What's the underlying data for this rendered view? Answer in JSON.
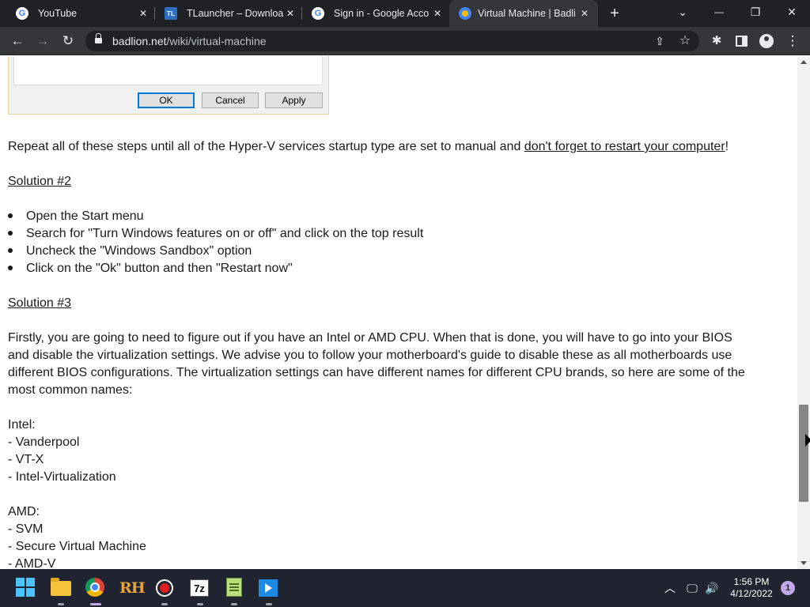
{
  "browser": {
    "tabs": [
      {
        "title": "YouTube",
        "close": "✕"
      },
      {
        "title": "TLauncher – Download",
        "favicon_text": "TL",
        "close": "✕"
      },
      {
        "title": "Sign in - Google Accou",
        "close": "✕"
      },
      {
        "title": "Virtual Machine | Badlio",
        "close": "✕"
      }
    ],
    "new_tab": "+",
    "window": {
      "dropdown": "⌄",
      "minimize": "—",
      "restore": "❐",
      "close": "✕"
    },
    "nav": {
      "back": "←",
      "forward": "→",
      "reload": "↻"
    },
    "url": {
      "host": "badlion.net",
      "path": "/wiki/virtual-machine"
    },
    "icons": {
      "share": "⇪",
      "bookmark": "☆",
      "extensions": "✱",
      "menu": "⋮"
    }
  },
  "dialog": {
    "ok_label": "OK",
    "cancel_label": "Cancel",
    "apply_label": "Apply"
  },
  "article": {
    "repeat_text": "Repeat all of these steps until all of the Hyper-V services startup type are set to manual and ",
    "repeat_link": "don't forget to restart your computer",
    "repeat_end": "!",
    "solution2_heading": "Solution #2",
    "solution2_steps": [
      "Open the Start menu",
      "Search for \"Turn Windows features on or off\" and click on the top result",
      "Uncheck the \"Windows Sandbox\" option",
      "Click on the \"Ok\" button and then \"Restart now\""
    ],
    "solution3_heading": "Solution #3",
    "solution3_paragraph": [
      "Firstly, you are going to need to figure out if you have an Intel or AMD CPU. When that is done, you will have to go into your BIOS",
      "and disable the virtualization settings. We advise you to follow your motherboard's guide to disable these as all motherboards use",
      "different BIOS configurations. The virtualization settings can have different names for different CPU brands, so here are some of the",
      "most common names:"
    ],
    "intel_label": "Intel:",
    "intel_names": [
      "- Vanderpool",
      "- VT-X",
      "- Intel-Virtualization"
    ],
    "amd_label": "AMD:",
    "amd_names": [
      "- SVM",
      "- Secure Virtual Machine",
      "- AMD-V"
    ]
  },
  "taskbar": {
    "apps": [
      "windows-start",
      "file-explorer",
      "google-chrome",
      "rh",
      "recorder",
      "7-zip",
      "notepad-plus-plus",
      "media-player"
    ],
    "active_app": "google-chrome",
    "z7_label": "7z",
    "rh_label": "RH",
    "tray": {
      "chevron": "︿",
      "network": "🖵",
      "volume": "🔊"
    },
    "time": "1:56 PM",
    "date": "4/12/2022",
    "notification_count": "1"
  }
}
